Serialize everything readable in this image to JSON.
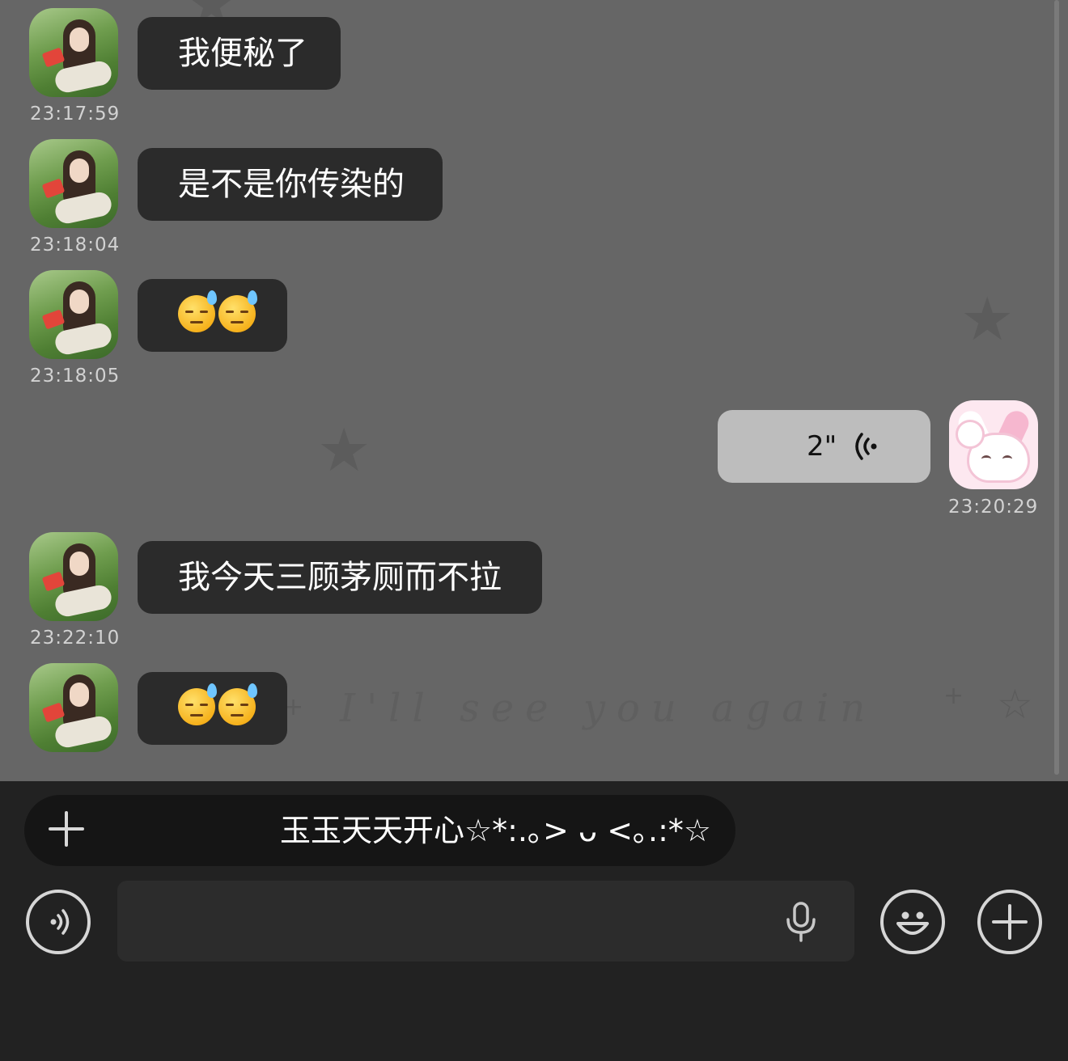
{
  "chat": {
    "watermark": "I'll see you again",
    "messages": [
      {
        "side": "left",
        "type": "text",
        "text": "我便秘了",
        "time": "23:17:59"
      },
      {
        "side": "left",
        "type": "text",
        "text": "是不是你传染的",
        "time": "23:18:04"
      },
      {
        "side": "left",
        "type": "emoji",
        "emoji": "😓😓",
        "time": "23:18:05"
      },
      {
        "side": "right",
        "type": "voice",
        "duration": "2\"",
        "time": "23:20:29"
      },
      {
        "side": "left",
        "type": "text",
        "text": "我今天三顾茅厕而不拉",
        "time": "23:22:10"
      },
      {
        "side": "left",
        "type": "emoji",
        "emoji": "😓😓",
        "time": ""
      }
    ]
  },
  "bottom": {
    "quick_reply": "玉玉天天开心☆*:.｡> ᴗ <｡.:*☆",
    "input": {
      "value": "",
      "placeholder": ""
    },
    "icons": {
      "voice_toggle": "voice-icon",
      "mic": "microphone-icon",
      "emoji": "emoji-icon",
      "more": "plus-icon",
      "quick_add": "plus-icon"
    }
  },
  "colors": {
    "chat_bg": "#666666",
    "incoming_bubble": "#2b2b2b",
    "outgoing_bubble": "#bdbdbd",
    "bottom_bar": "#222222"
  }
}
